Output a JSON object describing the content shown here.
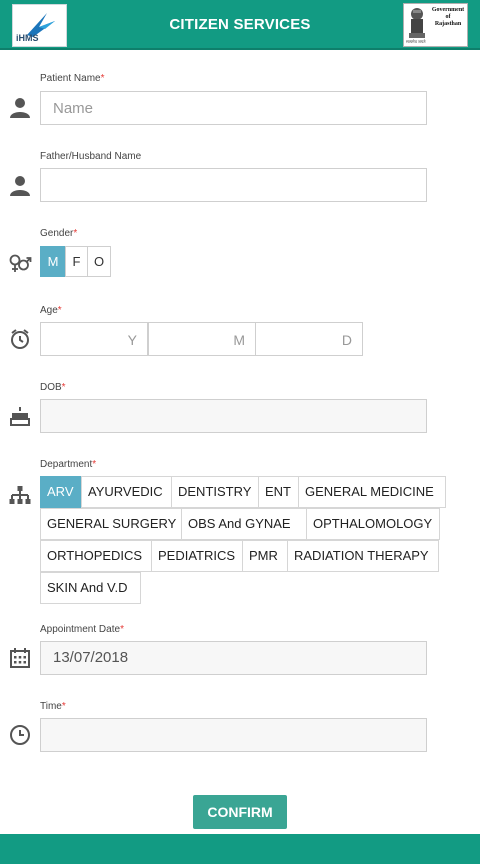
{
  "header": {
    "title": "CITIZEN SERVICES",
    "left_logo_text": "iHMS",
    "right_logo_text": [
      "Government",
      "of",
      "Rajasthan"
    ],
    "right_logo_sub": "सत्यमेव जयते",
    "color": "#129b83"
  },
  "form": {
    "patient_name": {
      "label": "Patient Name",
      "required": "*",
      "placeholder": "Name",
      "icon": "person-icon"
    },
    "father_name": {
      "label": "Father/Husband Name",
      "icon": "person-icon"
    },
    "gender": {
      "label": "Gender",
      "required": "*",
      "options": [
        "M",
        "F",
        "O"
      ],
      "selected": "M",
      "icon": "gender-icon"
    },
    "age": {
      "label": "Age",
      "required": "*",
      "units": [
        "Y",
        "M",
        "D"
      ],
      "icon": "age-icon"
    },
    "dob": {
      "label": "DOB",
      "required": "*",
      "icon": "cake-icon"
    },
    "department": {
      "label": "Department",
      "required": "*",
      "icon": "hierarchy-icon",
      "options": [
        "ARV",
        "AYURVEDIC",
        "DENTISTRY",
        "ENT",
        "GENERAL MEDICINE",
        "GENERAL SURGERY",
        "OBS And GYNAE",
        "OPTHALOMOLOGY",
        "ORTHOPEDICS",
        "PEDIATRICS",
        "PMR",
        "RADIATION THERAPY",
        "SKIN And V.D"
      ],
      "selected": "ARV"
    },
    "appointment_date": {
      "label": "Appointment Date",
      "required": "*",
      "value": "13/07/2018",
      "icon": "calendar-icon"
    },
    "time": {
      "label": "Time",
      "required": "*",
      "icon": "clock-icon"
    }
  },
  "confirm_label": "CONFIRM",
  "colors": {
    "accent": "#5aaec6",
    "button": "#3aa594",
    "required": "#e53935"
  }
}
